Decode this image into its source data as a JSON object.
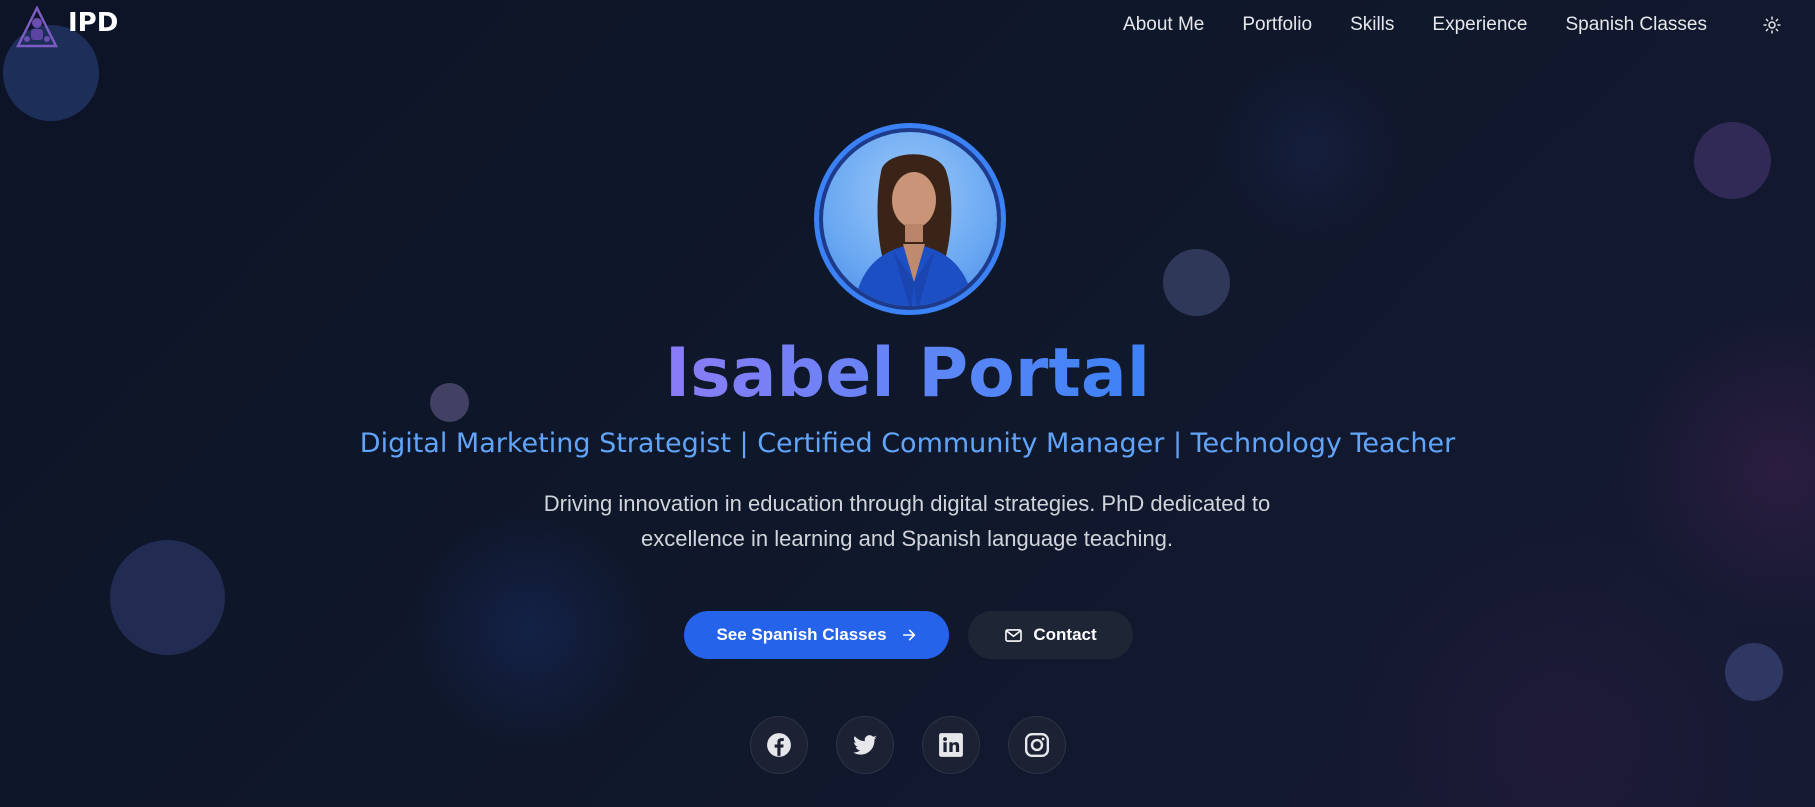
{
  "brand": {
    "name": "IPD",
    "logo_icon": "triangle-logo-icon"
  },
  "nav": {
    "items": [
      "About Me",
      "Portfolio",
      "Skills",
      "Experience",
      "Spanish Classes"
    ],
    "theme_toggle_icon": "sun-icon"
  },
  "hero": {
    "name": "Isabel Portal",
    "subtitle": "Digital Marketing Strategist | Certified Community Manager | Technology Teacher",
    "description": "Driving innovation in education through digital strategies. PhD dedicated to excellence in learning and Spanish language teaching.",
    "primary_button": {
      "label": "See Spanish Classes",
      "icon": "arrow-right-icon"
    },
    "secondary_button": {
      "label": "Contact",
      "icon": "mail-icon"
    }
  },
  "socials": [
    {
      "name": "facebook",
      "icon": "facebook-icon"
    },
    {
      "name": "twitter",
      "icon": "twitter-icon"
    },
    {
      "name": "linkedin",
      "icon": "linkedin-icon"
    },
    {
      "name": "instagram",
      "icon": "instagram-icon"
    }
  ],
  "colors": {
    "background": "#0f172a",
    "accent": "#3b82f6",
    "button_primary": "#2563eb",
    "subtitle": "#60a5fa"
  }
}
